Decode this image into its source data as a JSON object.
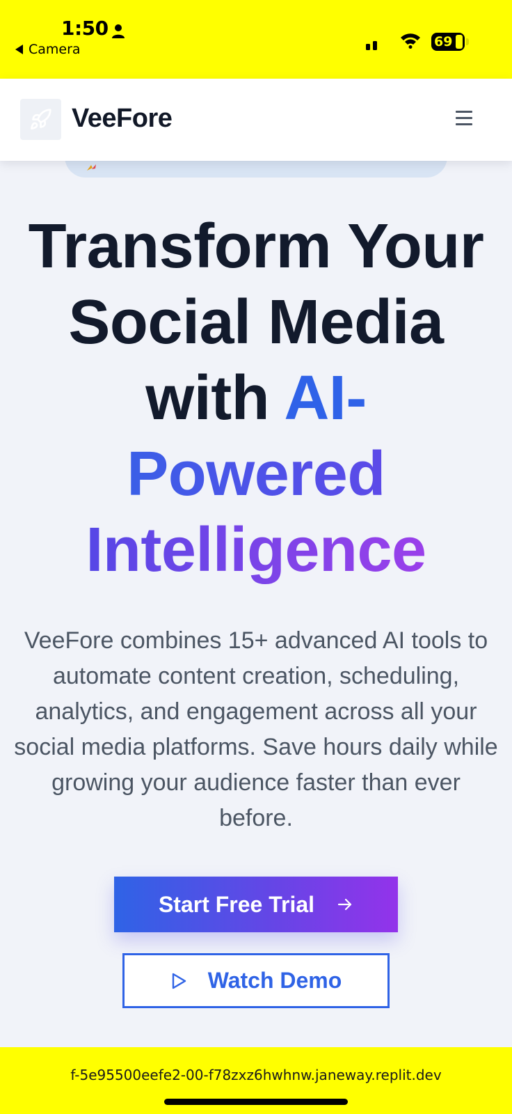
{
  "status_bar": {
    "time": "1:50",
    "back_label": "Camera",
    "battery_level": "69",
    "icons": [
      "person-icon",
      "signal-icon",
      "wifi-icon",
      "battery-icon"
    ]
  },
  "header": {
    "brand": "VeeFore",
    "logo_icon": "rocket-icon",
    "menu_icon": "hamburger-menu-icon"
  },
  "hero": {
    "title_line1": "Transform Your",
    "title_line2": "Social Media",
    "title_with": "with ",
    "title_ai": "AI-",
    "title_powered": "Powered",
    "title_intelligence": "Intelligence",
    "description": "VeeFore combines 15+ advanced AI tools to automate content creation, scheduling, analytics, and engagement across all your social media platforms. Save hours daily while growing your audience faster than ever before."
  },
  "actions": {
    "primary_label": "Start Free Trial",
    "secondary_label": "Watch Demo"
  },
  "browser": {
    "url": "f-5e95500eefe2-00-f78zxz6hwhnw.janeway.replit.dev"
  },
  "colors": {
    "status_bar_bg": "#ffff00",
    "accent_blue": "#2f63e6",
    "accent_purple": "#9333ea",
    "heading": "#121a2c",
    "body_text": "#4b5563"
  }
}
